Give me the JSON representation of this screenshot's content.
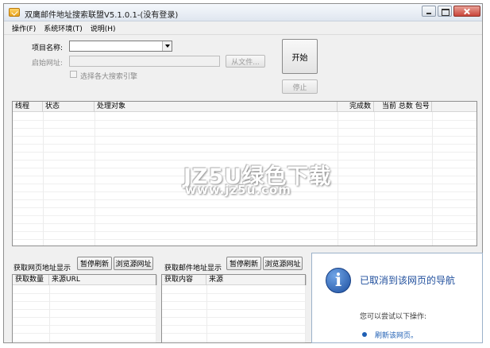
{
  "window": {
    "title": "双鹰邮件地址搜索联盟V5.1.0.1-(没有登录)"
  },
  "menu": [
    "操作(F)",
    "系统环境(T)",
    "说明(H)"
  ],
  "form": {
    "project_label": "项目名称:",
    "project_value": "",
    "start_url_label": "启始网址:",
    "start_url_value": "",
    "from_file_label": "从文件...",
    "checkbox_label": "选择各大搜索引擎",
    "start_label": "开始",
    "stop_label": "停止"
  },
  "main_table": {
    "columns": [
      "线程",
      "状态",
      "处理对象",
      "完成数",
      "当前 总数 包号"
    ],
    "rows": []
  },
  "watermark": {
    "brand": "JZ5U绿色下载",
    "url": "www.jz5u.com"
  },
  "url_section": {
    "title": "获取网页地址显示",
    "pause_label": "暂停刷新",
    "browse_label": "浏览源网址",
    "columns": [
      "获取数量",
      "来源URL"
    ]
  },
  "email_section": {
    "title": "获取邮件地址显示",
    "pause_label": "暂停刷新",
    "browse_label": "浏览源网址",
    "columns": [
      "获取内容",
      "来源"
    ]
  },
  "info_panel": {
    "title": "已取消到该网页的导航",
    "subtitle": "您可以尝试以下操作:",
    "link": "刷新该网页。"
  },
  "colors": {
    "info_title": "#1f4e9c",
    "link": "#1f5fb4"
  }
}
